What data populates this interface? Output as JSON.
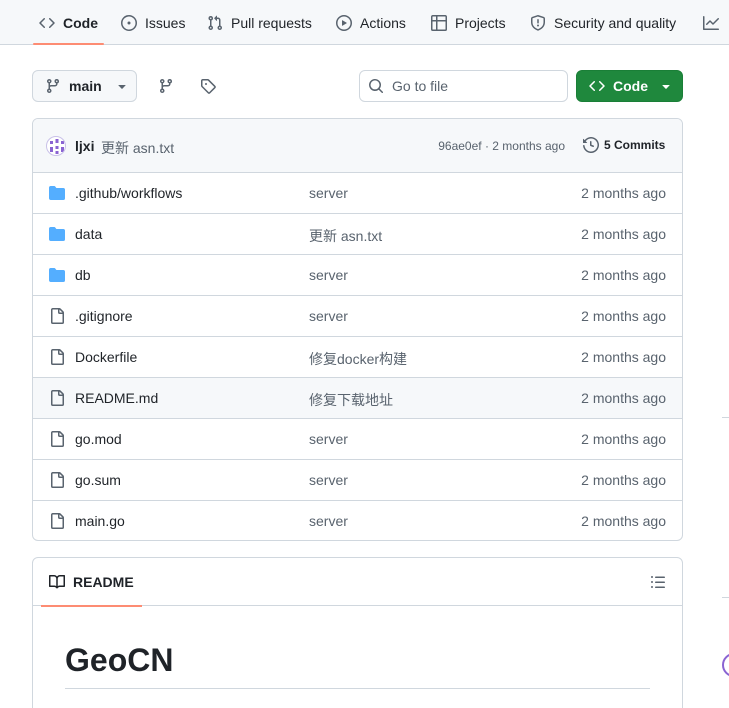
{
  "tabs": [
    {
      "label": "Code",
      "icon": "code-icon",
      "active": true
    },
    {
      "label": "Issues",
      "icon": "issue-opened-icon"
    },
    {
      "label": "Pull requests",
      "icon": "git-pull-request-icon"
    },
    {
      "label": "Actions",
      "icon": "play-icon"
    },
    {
      "label": "Projects",
      "icon": "table-icon"
    },
    {
      "label": "Security and quality",
      "icon": "shield-icon"
    }
  ],
  "toolbar": {
    "branch": "main",
    "goto_placeholder": "Go to file",
    "code_button": "Code"
  },
  "commit": {
    "author": "ljxi",
    "message": "更新 asn.txt",
    "meta": "96ae0ef · 2 months ago",
    "commits_label": "5 Commits"
  },
  "files": [
    {
      "name": ".github/workflows",
      "type": "folder",
      "message": "server",
      "date": "2 months ago"
    },
    {
      "name": "data",
      "type": "folder",
      "message": "更新 asn.txt",
      "date": "2 months ago"
    },
    {
      "name": "db",
      "type": "folder",
      "message": "server",
      "date": "2 months ago"
    },
    {
      "name": ".gitignore",
      "type": "file",
      "message": "server",
      "date": "2 months ago"
    },
    {
      "name": "Dockerfile",
      "type": "file",
      "message": "修复docker构建",
      "date": "2 months ago"
    },
    {
      "name": "README.md",
      "type": "file",
      "message": "修复下载地址",
      "date": "2 months ago"
    },
    {
      "name": "go.mod",
      "type": "file",
      "message": "server",
      "date": "2 months ago"
    },
    {
      "name": "go.sum",
      "type": "file",
      "message": "server",
      "date": "2 months ago"
    },
    {
      "name": "main.go",
      "type": "file",
      "message": "server",
      "date": "2 months ago"
    }
  ],
  "readme": {
    "tab_label": "README",
    "heading": "GeoCN"
  },
  "colors": {
    "accent_underline": "#fd8c73",
    "code_button": "#1f883d",
    "folder": "#54aeff"
  }
}
